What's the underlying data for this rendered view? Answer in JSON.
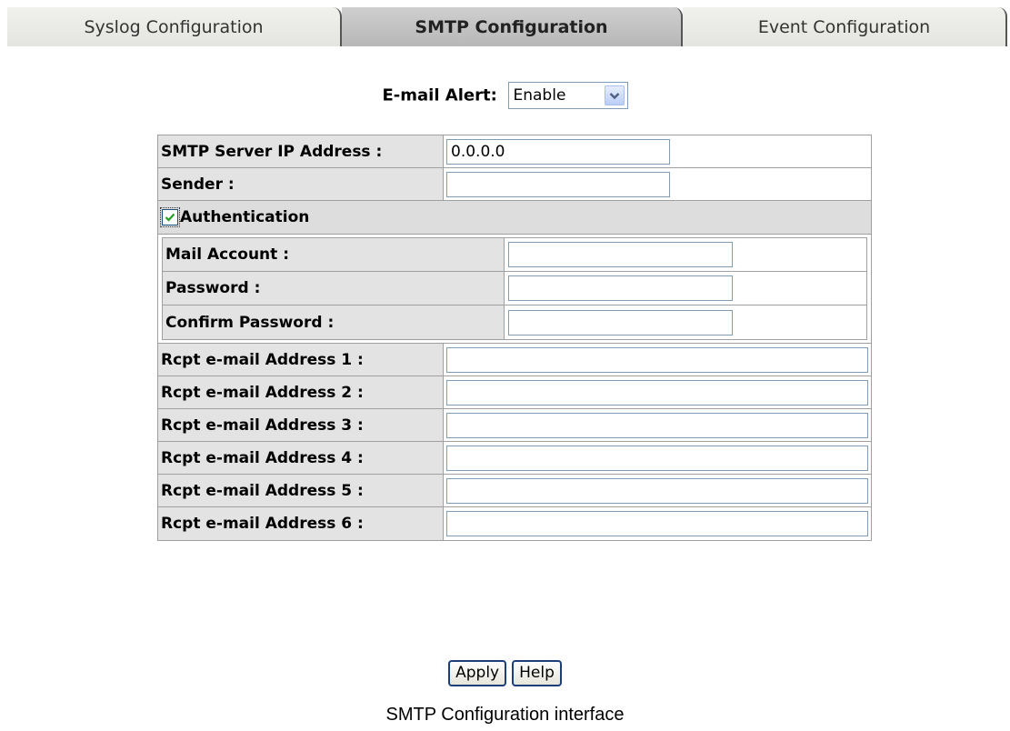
{
  "tabs": [
    {
      "label": "Syslog Configuration",
      "active": false
    },
    {
      "label": "SMTP Configuration",
      "active": true
    },
    {
      "label": "Event Configuration",
      "active": false
    }
  ],
  "email_alert": {
    "label": "E-mail Alert:",
    "selected": "Enable"
  },
  "smtp": {
    "server_label": "SMTP Server IP Address :",
    "server_value": "0.0.0.0",
    "sender_label": "Sender :",
    "sender_value": ""
  },
  "auth": {
    "label": "Authentication",
    "checked": true,
    "mail_account_label": "Mail Account :",
    "password_label": "Password :",
    "confirm_label": "Confirm Password :"
  },
  "recipients": [
    {
      "label": "Rcpt e-mail Address 1 :",
      "value": ""
    },
    {
      "label": "Rcpt e-mail Address 2 :",
      "value": ""
    },
    {
      "label": "Rcpt e-mail Address 3 :",
      "value": ""
    },
    {
      "label": "Rcpt e-mail Address 4 :",
      "value": ""
    },
    {
      "label": "Rcpt e-mail Address 5 :",
      "value": ""
    },
    {
      "label": "Rcpt e-mail Address 6 :",
      "value": ""
    }
  ],
  "buttons": {
    "apply": "Apply",
    "help": "Help"
  },
  "caption": "SMTP Configuration interface",
  "colors": {
    "label_bg": "#e3e3e3",
    "input_border": "#7f9db9",
    "active_tab": "#c0c0c0",
    "check": "#21a121"
  }
}
